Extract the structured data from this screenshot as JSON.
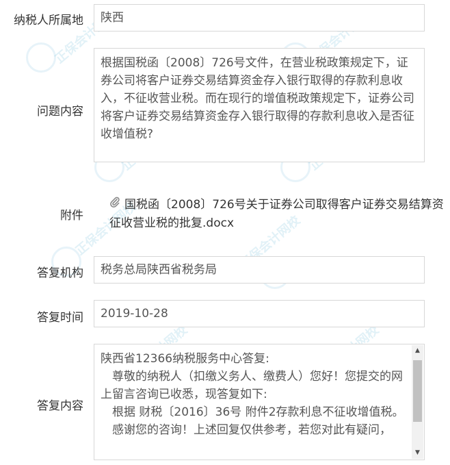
{
  "labels": {
    "region": "纳税人所属地",
    "question": "问题内容",
    "attachment": "附件",
    "org": "答复机构",
    "time": "答复时间",
    "answer": "答复内容"
  },
  "values": {
    "region": "陕西",
    "question": "根据国税函〔2008〕726号文件，在营业税政策规定下，证券公司将客户证券交易结算资金存入银行取得的存款利息收入，不征收营业税。而在现行的增值税政策规定下，证券公司将客户证券交易结算资金存入银行取得的存款利息收入是否征收增值税?",
    "attachment": "国税函〔2008〕726号关于证券公司取得客户证券交易结算资征收营业税的批复.docx",
    "org": "税务总局陕西省税务局",
    "time": "2019-10-28",
    "answer_lines": [
      "陕西省12366纳税服务中心答复:",
      "　尊敬的纳税人（扣缴义务人、缴费人）您好！您提交的网上留言咨询已收悉，现答复如下:",
      "　根据 财税〔2016〕36号 附件2存款利息不征收增值税。",
      "　感谢您的咨询！上述回复仅供参考，若您对此有疑问，"
    ]
  },
  "icons": {
    "attachment": "paperclip-icon",
    "scroll_up": "scroll-up-arrow-icon",
    "scroll_down": "scroll-down-arrow-icon"
  },
  "watermark": {
    "text": "正保会计网校",
    "subtext": "www.chinaacc.com"
  }
}
